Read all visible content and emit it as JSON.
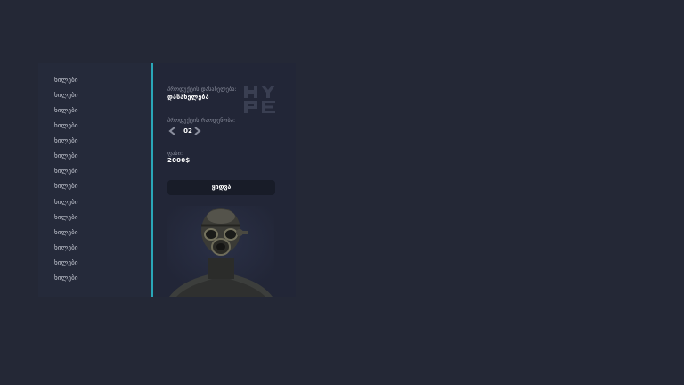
{
  "list": {
    "items": [
      {
        "label": "ხილები"
      },
      {
        "label": "ხილები"
      },
      {
        "label": "ხილები"
      },
      {
        "label": "ხილები"
      },
      {
        "label": "ხილები"
      },
      {
        "label": "ხილები"
      },
      {
        "label": "ხილები"
      },
      {
        "label": "ხილები"
      },
      {
        "label": "ხილები"
      },
      {
        "label": "ხილები"
      },
      {
        "label": "ხილები"
      },
      {
        "label": "ხილები"
      },
      {
        "label": "ხილები"
      },
      {
        "label": "ხილები"
      }
    ]
  },
  "detail": {
    "product_label": "პროდუქტის დასახელება:",
    "product_value": "დასახელება",
    "quantity_label": "პროდუქტის რაოდენობა:",
    "quantity_value": "02",
    "price_label": "ფასი:",
    "price_value": "2000$",
    "buy_label": "ყიდვა"
  },
  "logo": {
    "text": "HYPE"
  },
  "colors": {
    "background": "#242836",
    "panel": "#222637",
    "accent": "#2aa7b8"
  }
}
